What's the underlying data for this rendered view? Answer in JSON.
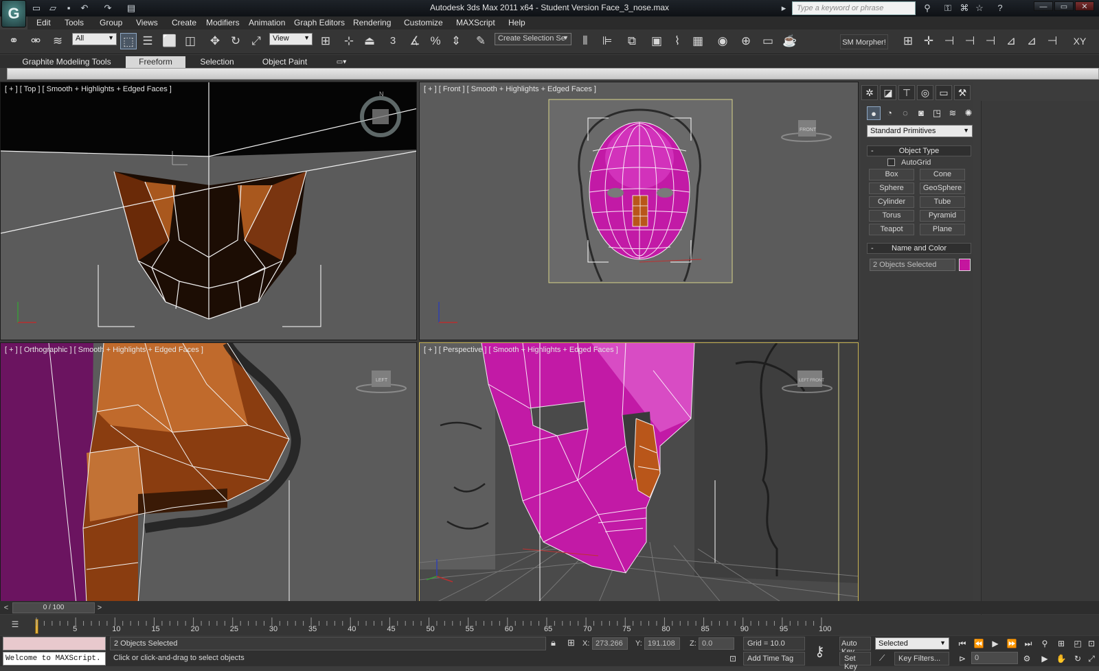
{
  "app": {
    "title": "Autodesk 3ds Max  2011 x64  - Student Version    Face_3_nose.max",
    "logo_letter": "G",
    "search_placeholder": "Type a keyword or phrase"
  },
  "menu": [
    "Edit",
    "Tools",
    "Group",
    "Views",
    "Create",
    "Modifiers",
    "Animation",
    "Graph Editors",
    "Rendering",
    "Customize",
    "MAXScript",
    "Help"
  ],
  "toolbar": {
    "selection_filter": "All",
    "ref_coord": "View",
    "named_selection": "Create Selection Se",
    "sm_morpher": "SM Morpher!",
    "snap_label": "3",
    "xy_label": "XY"
  },
  "ribbon": {
    "tabs": [
      "Graphite Modeling Tools",
      "Freeform",
      "Selection",
      "Object Paint"
    ],
    "active_tab": "Freeform"
  },
  "viewports": {
    "top": "[ + ] [ Top ] [ Smooth + Highlights + Edged Faces ]",
    "front": "[ + ] [ Front ] [ Smooth + Highlights + Edged Faces ]",
    "ortho": "[ + ] [ Orthographic ] [ Smooth + Highlights + Edged Faces ]",
    "perspective": "[ + ] [ Perspective ] [ Smooth + Highlights + Edged Faces ]",
    "viewcube_front": "FRONT",
    "viewcube_left": "LEFT",
    "viewcube_persp": "LEFT   FRONT"
  },
  "command_panel": {
    "dropdown": "Standard Primitives",
    "object_type_title": "Object Type",
    "autogrid_label": "AutoGrid",
    "buttons": [
      "Box",
      "Cone",
      "Sphere",
      "GeoSphere",
      "Cylinder",
      "Tube",
      "Torus",
      "Pyramid",
      "Teapot",
      "Plane"
    ],
    "name_color_title": "Name and Color",
    "name_value": "2 Objects Selected",
    "color": "#c4169e"
  },
  "timeline": {
    "frame_indicator": "0 / 100",
    "ticks": [
      "5",
      "10",
      "15",
      "20",
      "25",
      "30",
      "35",
      "40",
      "45",
      "50",
      "55",
      "60",
      "65",
      "70",
      "75",
      "80",
      "85",
      "90",
      "95",
      "100"
    ]
  },
  "status": {
    "maxscript_text": "Welcome to MAXScript.",
    "selection_info": "2 Objects Selected",
    "prompt": "Click or click-and-drag to select objects",
    "x_label": "X:",
    "x_value": "273.266",
    "y_label": "Y:",
    "y_value": "191.108",
    "z_label": "Z:",
    "z_value": "0.0",
    "grid": "Grid = 10.0",
    "add_time_tag": "Add Time Tag",
    "auto_key": "Auto Key",
    "set_key": "Set Key",
    "key_mode": "Selected",
    "key_filters": "Key Filters...",
    "frame_value": "0"
  },
  "colors": {
    "mesh_magenta": "#c21aa6",
    "mesh_orange": "#b9561a",
    "viewport_bg": "#5b5b5b",
    "active_border": "#c9b454"
  }
}
